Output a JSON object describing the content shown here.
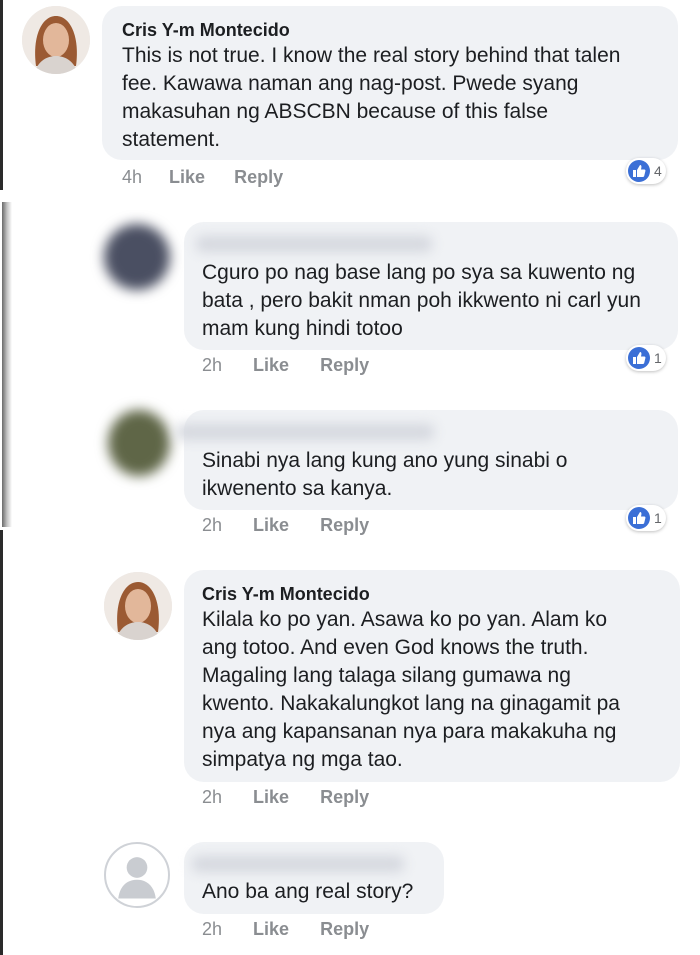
{
  "comments": [
    {
      "author": "Cris Y-m Montecido",
      "text": "This is not true. I know the real story behind that talen\nfee. Kawawa naman ang nag-post. Pwede syang\nmakasuhan ng ABSCBN because of this false\nstatement.",
      "time": "4h",
      "like": "Like",
      "reply": "Reply",
      "reactions": "4"
    },
    {
      "author": "",
      "text": "Cguro po nag base lang po sya sa kuwento ng\nbata , pero bakit nman poh ikkwento ni carl yun\nmam kung hindi totoo",
      "time": "2h",
      "like": "Like",
      "reply": "Reply",
      "reactions": "1"
    },
    {
      "author": "",
      "text": "Sinabi nya lang kung ano yung sinabi o\nikwenento sa kanya.",
      "time": "2h",
      "like": "Like",
      "reply": "Reply",
      "reactions": "1"
    },
    {
      "author": "Cris Y-m Montecido",
      "text": "Kilala ko  po yan. Asawa ko po yan. Alam ko\nang totoo. And even God knows the truth.\nMagaling lang talaga silang gumawa ng\nkwento. Nakakalungkot lang na ginagamit pa\nnya ang kapansanan nya para makakuha ng\nsimpatya ng mga tao.",
      "time": "2h",
      "like": "Like",
      "reply": "Reply"
    },
    {
      "author": "",
      "text": "Ano ba ang real story?",
      "time": "2h",
      "like": "Like",
      "reply": "Reply"
    }
  ],
  "colors": {
    "bubble": "#f0f2f5",
    "like_blue": "#3b6fd6",
    "meta_gray": "#8a8d91"
  }
}
